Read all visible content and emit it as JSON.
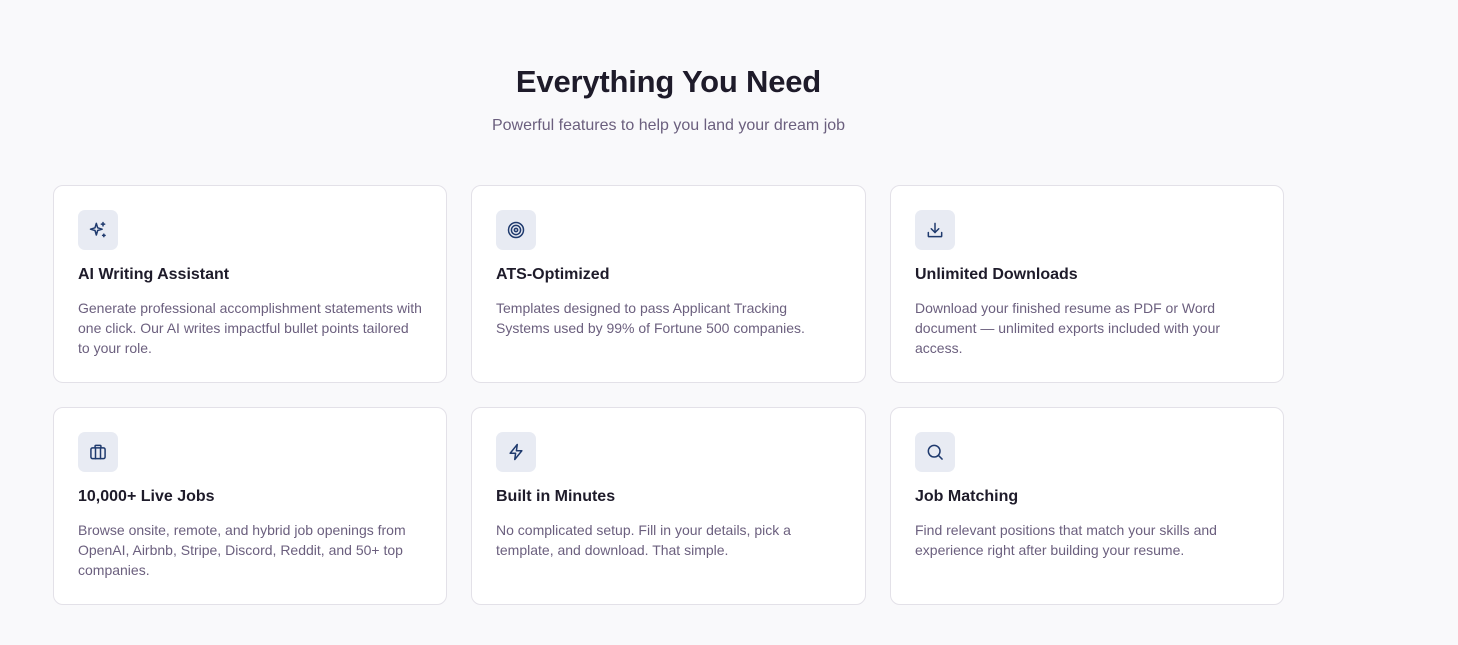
{
  "header": {
    "title": "Everything You Need",
    "subtitle": "Powerful features to help you land your dream job"
  },
  "features": [
    {
      "icon": "sparkles-icon",
      "title": "AI Writing Assistant",
      "description": "Generate professional accomplishment statements with one click. Our AI writes impactful bullet points tailored to your role."
    },
    {
      "icon": "target-icon",
      "title": "ATS-Optimized",
      "description": "Templates designed to pass Applicant Tracking Systems used by 99% of Fortune 500 companies."
    },
    {
      "icon": "download-icon",
      "title": "Unlimited Downloads",
      "description": "Download your finished resume as PDF or Word document — unlimited exports included with your access."
    },
    {
      "icon": "briefcase-icon",
      "title": "10,000+ Live Jobs",
      "description": "Browse onsite, remote, and hybrid job openings from OpenAI, Airbnb, Stripe, Discord, Reddit, and 50+ top companies."
    },
    {
      "icon": "lightning-icon",
      "title": "Built in Minutes",
      "description": "No complicated setup. Fill in your details, pick a template, and download. That simple."
    },
    {
      "icon": "search-icon",
      "title": "Job Matching",
      "description": "Find relevant positions that match your skills and experience right after building your resume."
    }
  ],
  "colors": {
    "background": "#f9f9fb",
    "card": "#ffffff",
    "icon_tile": "#e8ebf3",
    "icon_stroke": "#1f3a6e",
    "heading": "#1e1b2a",
    "muted_text": "#6b5f7e"
  }
}
